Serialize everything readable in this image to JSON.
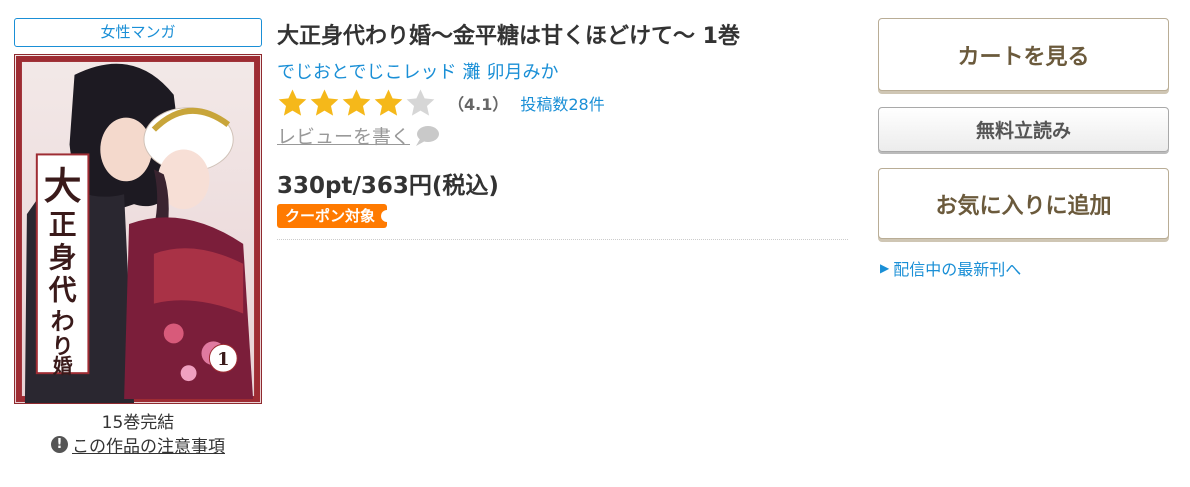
{
  "genre": "女性マンガ",
  "cover": {
    "title_vertical": "大正身代わり婚",
    "volume_number": "1"
  },
  "series_status": "15巻完結",
  "notice_link": "この作品の注意事項",
  "title": "大正身代わり婚～金平糖は甘くほどけて～ 1巻",
  "authors": [
    "でじおとでじこレッド",
    "灘",
    "卯月みか"
  ],
  "rating": {
    "stars_filled": 4,
    "stars_total": 5,
    "value_text": "（4.1）",
    "review_count_text": "投稿数28件"
  },
  "write_review_label": "レビューを書く",
  "price": "330pt/363円(税込)",
  "coupon_label": "クーポン対象",
  "buttons": {
    "cart": "カートを見る",
    "sample": "無料立読み",
    "favorite": "お気に入りに追加"
  },
  "latest_link": "配信中の最新刊へ",
  "colors": {
    "link_blue": "#1a8fd6",
    "star_gold": "#f5b81a",
    "coupon_orange": "#ff7a00",
    "button_text": "#6b5a3c"
  }
}
